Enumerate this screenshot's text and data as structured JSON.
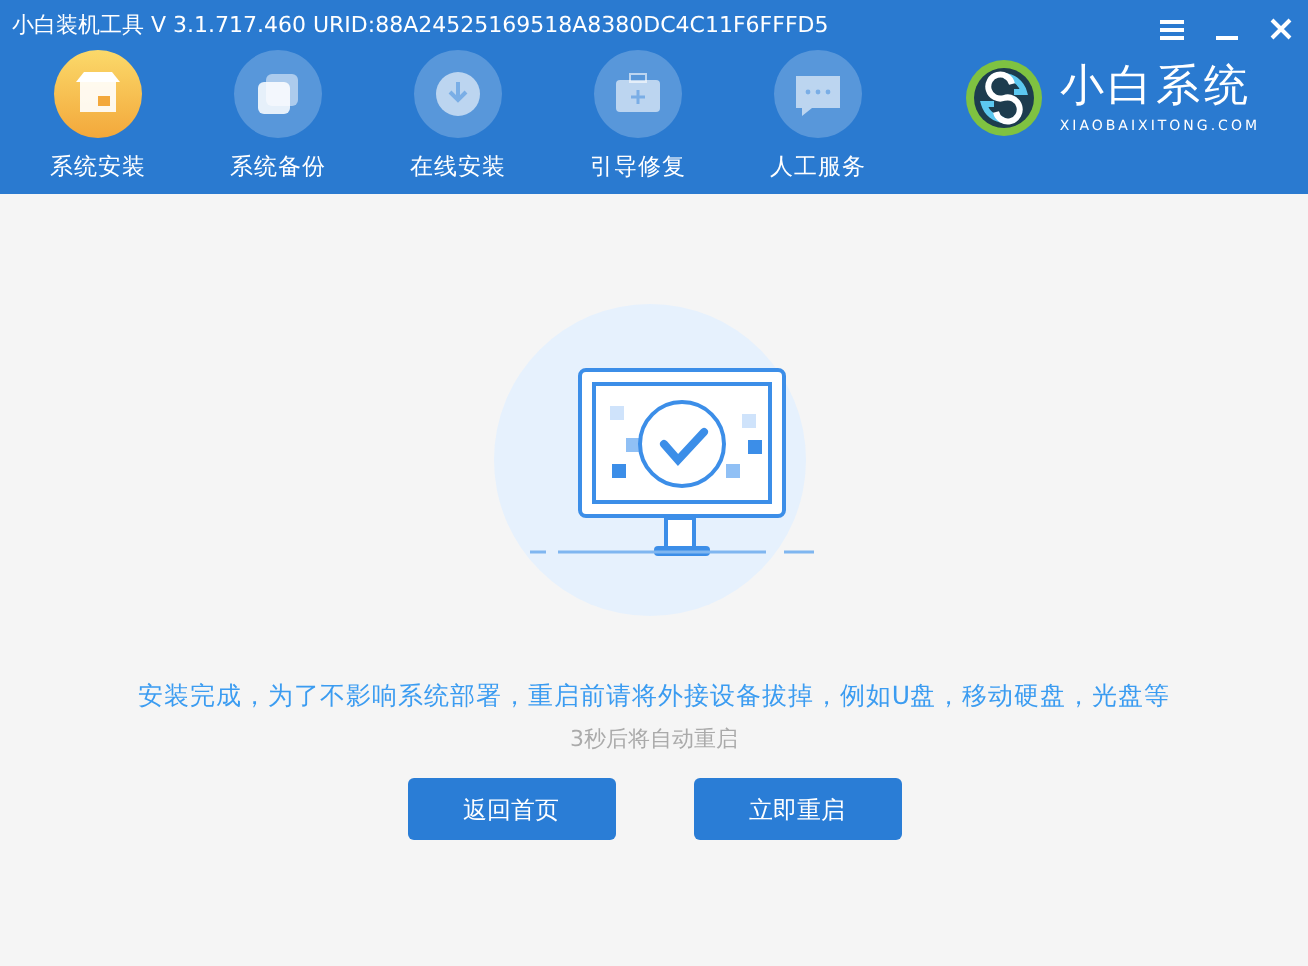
{
  "window": {
    "title": "小白装机工具 V 3.1.717.460 URID:88A24525169518A8380DC4C11F6FFFD5"
  },
  "nav": [
    {
      "label": "系统安装",
      "selected": true
    },
    {
      "label": "系统备份",
      "selected": false
    },
    {
      "label": "在线安装",
      "selected": false
    },
    {
      "label": "引导修复",
      "selected": false
    },
    {
      "label": "人工服务",
      "selected": false
    }
  ],
  "logo": {
    "name": "小白系统",
    "domain": "XIAOBAIXITONG.COM"
  },
  "message": "安装完成，为了不影响系统部署，重启前请将外接设备拔掉，例如U盘，移动硬盘，光盘等",
  "countdown": "3秒后将自动重启",
  "buttons": [
    "返回首页",
    "立即重启"
  ]
}
